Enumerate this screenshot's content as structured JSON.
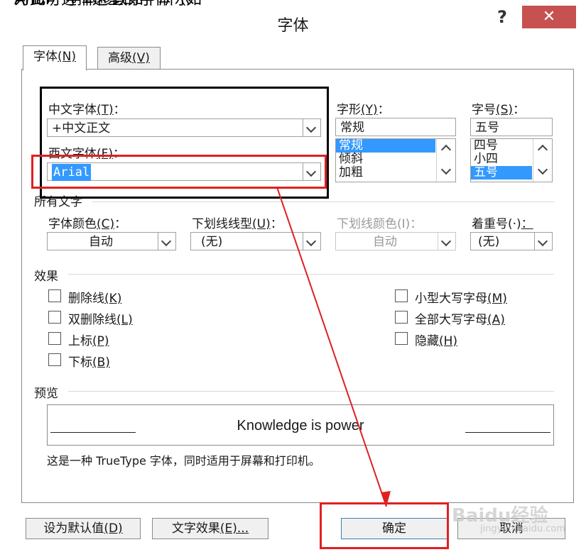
{
  "top_caption": "为此可选择这里的字体（如 Arial）字体修改如下所示",
  "dialog": {
    "title": "字体",
    "help_label": "?",
    "close_label": "✕"
  },
  "tabs": [
    {
      "label": "字体",
      "key": "(N)"
    },
    {
      "label": "高级",
      "key": "(V)"
    }
  ],
  "font": {
    "chinese_label": "中文字体",
    "chinese_key": "(T)",
    "chinese_value": "+中文正文",
    "western_label": "西文字体",
    "western_key": "(F)",
    "western_value": "Arial",
    "style_label": "字形",
    "style_key": "(Y)",
    "style_value": "常规",
    "style_list": [
      "常规",
      "倾斜",
      "加粗"
    ],
    "size_label": "字号",
    "size_key": "(S)",
    "size_value": "五号",
    "size_list": [
      "四号",
      "小四",
      "五号"
    ]
  },
  "all_text": {
    "heading": "所有文字",
    "color_label": "字体颜色",
    "color_key": "(C)",
    "color_value": "自动",
    "underline_label": "下划线线型",
    "underline_key": "(U)",
    "underline_value": "(无)",
    "ucolor_label": "下划线颜色(I)：",
    "ucolor_value": "自动",
    "emphasis_label": "着重号(·)",
    "emphasis_value": "(无)"
  },
  "effects": {
    "heading": "效果",
    "left": [
      {
        "label": "删除线",
        "key": "(K)"
      },
      {
        "label": "双删除线",
        "key": "(L)"
      },
      {
        "label": "上标",
        "key": "(P)"
      },
      {
        "label": "下标",
        "key": "(B)"
      }
    ],
    "right": [
      {
        "label": "小型大写字母",
        "key": "(M)"
      },
      {
        "label": "全部大写字母",
        "key": "(A)"
      },
      {
        "label": "隐藏",
        "key": "(H)"
      }
    ]
  },
  "preview": {
    "heading": "预览",
    "sample": "Knowledge is power",
    "note": "这是一种 TrueType 字体，同时适用于屏幕和打印机。"
  },
  "buttons": {
    "default_label": "设为默认值",
    "default_key": "(D)",
    "effects_label": "文字效果",
    "effects_key": "(E)...",
    "ok_label": "确定",
    "cancel_label": "取消"
  },
  "watermark": {
    "text": "Baidu经验",
    "sub": "jingyan.baidu.com"
  },
  "colors": {
    "annotation_red": "#e02020",
    "selection_blue": "#3399ff",
    "close_red": "#c75050"
  }
}
